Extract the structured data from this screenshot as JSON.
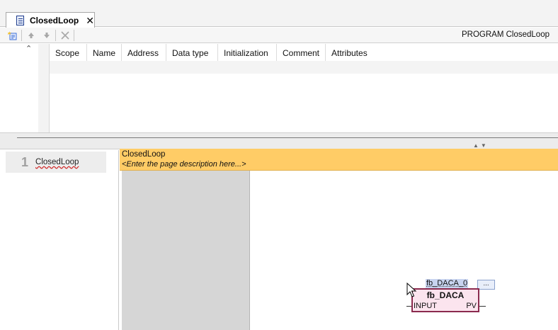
{
  "tab": {
    "label": "ClosedLoop",
    "close_glyph": "✕",
    "icon": "document-icon"
  },
  "toolbar": {
    "program_title": "PROGRAM ClosedLoop",
    "icons": [
      "add-variable-icon",
      "move-up-icon",
      "move-down-icon",
      "delete-icon"
    ]
  },
  "declaration": {
    "collapse_glyph": "⌃",
    "columns": [
      "Scope",
      "Name",
      "Address",
      "Data type",
      "Initialization",
      "Comment",
      "Attributes"
    ]
  },
  "pages": [
    {
      "number": "1",
      "name": "ClosedLoop"
    }
  ],
  "editor": {
    "page_title": "ClosedLoop",
    "page_description": "<Enter the page description here...>"
  },
  "function_block": {
    "instance": "fb_DACA_0",
    "type": "fb_DACA",
    "input": "INPUT",
    "output": "PV",
    "assist_label": "..."
  },
  "colors": {
    "page_header": "#ffcc66",
    "fb_border": "#8b2a4e",
    "fb_fill": "#fbe4ee",
    "instance_highlight": "#c8d4f0"
  }
}
